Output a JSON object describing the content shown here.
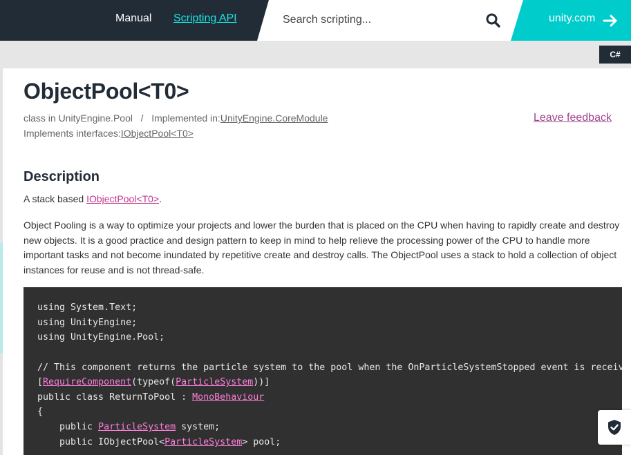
{
  "header": {
    "nav": {
      "manual": "Manual",
      "scripting_api": "Scripting API"
    },
    "search": {
      "placeholder": "Search scripting..."
    },
    "unity_link": "unity.com"
  },
  "toolbar": {
    "language": "C#"
  },
  "page": {
    "title": "ObjectPool<T0>",
    "meta": {
      "class_in_prefix": "class in UnityEngine.Pool",
      "separator": "/",
      "implemented_in_label": "Implemented in:",
      "implemented_in_link": "UnityEngine.CoreModule",
      "interfaces_label": "Implements interfaces:",
      "interfaces_link": "IObjectPool<T0>"
    },
    "feedback": "Leave feedback",
    "description": {
      "heading": "Description",
      "summary_prefix": "A stack based ",
      "summary_link": "IObjectPool<T0>",
      "summary_suffix": ".",
      "body": "Object Pooling is a way to optimize your projects and lower the burden that is placed on the CPU when having to rapidly create and destroy new objects. It is a good practice and design pattern to keep in mind to help relieve the processing power of the CPU to handle more important tasks and not become inundated by repetitive create and destroy calls. The ObjectPool uses a stack to hold a collection of object instances for reuse and is not thread-safe."
    }
  },
  "code": {
    "l1": "using System.Text;",
    "l2": "using UnityEngine;",
    "l3": "using UnityEngine.Pool;",
    "l4": "// This component returns the particle system to the pool when the OnParticleSystemStopped event is received.",
    "l5_a": "[",
    "l5_link1": "RequireComponent",
    "l5_b": "(typeof(",
    "l5_link2": "ParticleSystem",
    "l5_c": "))]",
    "l6_a": "public class ReturnToPool : ",
    "l6_link": "MonoBehaviour",
    "l7": "{",
    "l8_a": "    public ",
    "l8_link": "ParticleSystem",
    "l8_b": " system;",
    "l9_a": "    public IObjectPool<",
    "l9_link": "ParticleSystem",
    "l9_b": "> pool;"
  },
  "icons": {
    "search": "search-icon",
    "arrow": "arrow-right-icon",
    "shield": "shield-check-icon"
  },
  "colors": {
    "header_bg": "#222c37",
    "accent_teal": "#00cccc",
    "link_pink": "#c4348e",
    "code_bg": "#303030"
  }
}
